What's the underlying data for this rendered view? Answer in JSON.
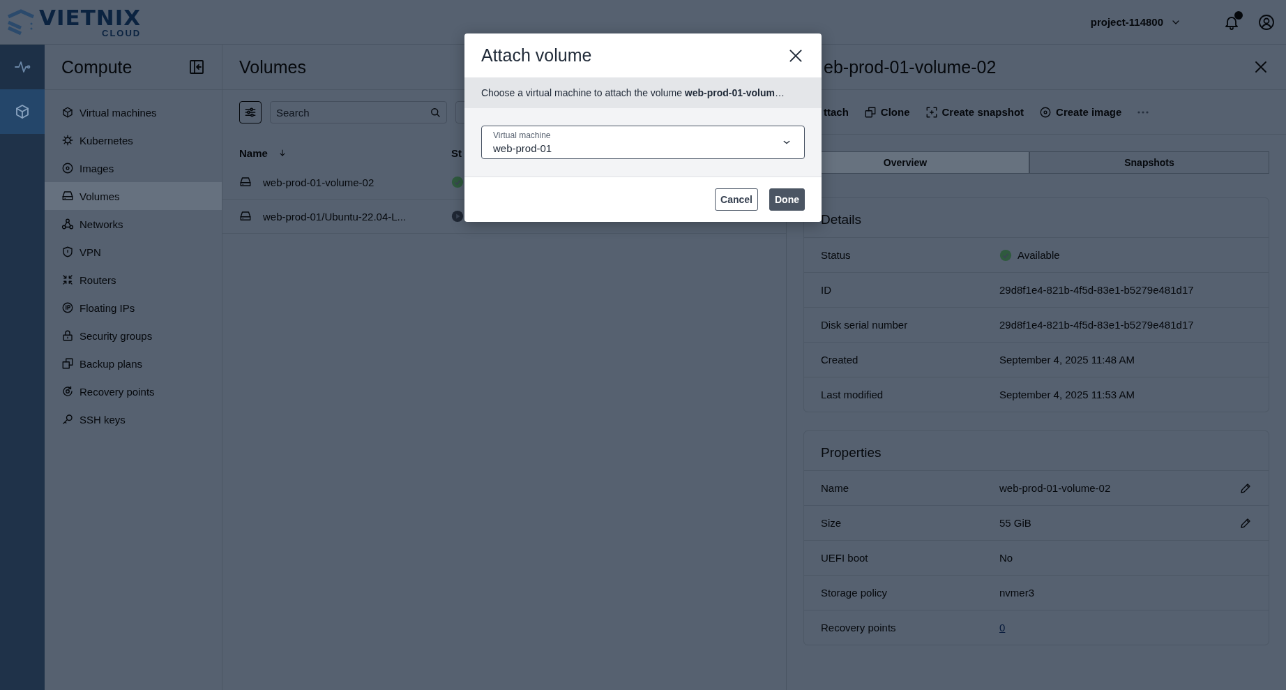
{
  "header": {
    "logo": {
      "name": "VIETNIX",
      "sub": "CLOUD"
    },
    "project": "project-114800"
  },
  "rail": [
    {
      "kind": "activity",
      "selected": false
    },
    {
      "kind": "compute",
      "selected": true
    }
  ],
  "nav": {
    "title": "Compute",
    "items": [
      {
        "label": "Virtual machines",
        "kind": "cube",
        "selected": false
      },
      {
        "label": "Kubernetes",
        "kind": "helm",
        "selected": false
      },
      {
        "label": "Images",
        "kind": "disc",
        "selected": false
      },
      {
        "label": "Volumes",
        "kind": "drive",
        "selected": true
      },
      {
        "label": "Networks",
        "kind": "network",
        "selected": false
      },
      {
        "label": "VPN",
        "kind": "shield",
        "selected": false
      },
      {
        "label": "Routers",
        "kind": "router",
        "selected": false
      },
      {
        "label": "Floating IPs",
        "kind": "ip",
        "selected": false
      },
      {
        "label": "Security groups",
        "kind": "lock",
        "selected": false
      },
      {
        "label": "Backup plans",
        "kind": "backup",
        "selected": false
      },
      {
        "label": "Recovery points",
        "kind": "recovery",
        "selected": false
      },
      {
        "label": "SSH keys",
        "kind": "key",
        "selected": false
      }
    ]
  },
  "volumes": {
    "title": "Volumes",
    "search": {
      "placeholder": "Search"
    },
    "columns": [
      "Name",
      "St"
    ],
    "rows": [
      {
        "name": "web-prod-01-volume-02",
        "kind": "available"
      },
      {
        "name": "web-prod-01/Ubuntu-22.04-L...",
        "kind": "running"
      }
    ]
  },
  "detail": {
    "title": "eb-prod-01-volume-02",
    "actions": [
      {
        "label": "ttach",
        "kind": "text"
      },
      {
        "label": "Clone",
        "kind": "clone"
      },
      {
        "label": "Create snapshot",
        "kind": "snapshot"
      },
      {
        "label": "Create image",
        "kind": "image"
      },
      {
        "kind": "more"
      }
    ],
    "tabs": [
      {
        "label": "Overview",
        "selected": true
      },
      {
        "label": "Snapshots",
        "selected": false
      }
    ],
    "sections": [
      {
        "title": "Details",
        "rows": [
          {
            "label": "Status",
            "value": "Available",
            "kind": "status",
            "editable": false
          },
          {
            "label": "ID",
            "value": "29d8f1e4-821b-4f5d-83e1-b5279e481d17",
            "kind": "text",
            "editable": false
          },
          {
            "label": "Disk serial number",
            "value": "29d8f1e4-821b-4f5d-83e1-b5279e481d17",
            "kind": "text",
            "editable": false
          },
          {
            "label": "Created",
            "value": "September 4, 2025 11:48 AM",
            "kind": "text",
            "editable": false
          },
          {
            "label": "Last modified",
            "value": "September 4, 2025 11:53 AM",
            "kind": "text",
            "editable": false
          }
        ]
      },
      {
        "title": "Properties",
        "rows": [
          {
            "label": "Name",
            "value": "web-prod-01-volume-02",
            "kind": "text",
            "editable": true
          },
          {
            "label": "Size",
            "value": "55 GiB",
            "kind": "text",
            "editable": true
          },
          {
            "label": "UEFI boot",
            "value": "No",
            "kind": "text",
            "editable": false
          },
          {
            "label": "Storage policy",
            "value": "nvmer3",
            "kind": "text",
            "editable": false
          },
          {
            "label": "Recovery points",
            "value": "0",
            "kind": "link",
            "editable": false
          }
        ]
      }
    ]
  },
  "dialog": {
    "title": "Attach volume",
    "message": "Choose a virtual machine to attach the volume **web-prod-01-volum**…",
    "field": {
      "label": "Virtual machine",
      "value": "web-prod-01"
    },
    "buttons": [
      {
        "label": "Cancel",
        "kind": "secondary"
      },
      {
        "label": "Done",
        "kind": "primary"
      }
    ]
  }
}
